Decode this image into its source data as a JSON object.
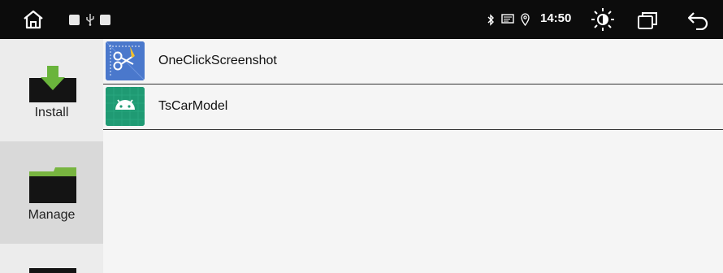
{
  "status_bar": {
    "time": "14:50"
  },
  "sidebar": {
    "items": [
      {
        "label": "Install"
      },
      {
        "label": "Manage"
      }
    ]
  },
  "apps": [
    {
      "name": "OneClickScreenshot",
      "icon": "scissors-icon"
    },
    {
      "name": "TsCarModel",
      "icon": "android-icon"
    }
  ],
  "colors": {
    "status_bar_bg": "#0c0c0c",
    "sidebar_bg": "#ececec",
    "sidebar_selected_bg": "#d9d9d9",
    "install_arrow_green": "#6ab43c",
    "folder_green": "#78b540",
    "screenshot_icon_blue": "#3f6fc4",
    "android_icon_teal": "#1f9a73"
  }
}
